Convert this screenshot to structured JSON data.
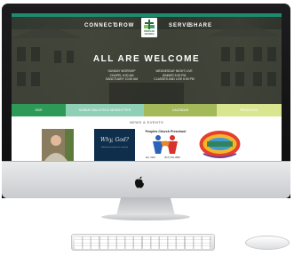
{
  "nav": {
    "connect": "CONNECT",
    "grow": "GROW",
    "serve": "SERVE",
    "share": "SHARE",
    "logo_text": "PEOPLES CHURCH"
  },
  "hero": {
    "headline": "ALL ARE WELCOME",
    "service_left": [
      "SUNDAY WORSHIP",
      "CHAPEL 8:30 AM",
      "SANCTUARY 10:30 AM"
    ],
    "service_right": [
      "WEDNESDAY NIGHT LIVE",
      "DINNER 5:30 PM",
      "CLASSES AND LIVE 6:30 PM"
    ]
  },
  "tabs": [
    "GIVE",
    "SUNDAY BULLETIN & NEWSLETTER",
    "CALENDAR",
    "PRESCHOOL"
  ],
  "news": {
    "title": "NEWS & EVENTS",
    "why_god_title": "Why, God?",
    "why_god_sub": "Suffering through loss and pain",
    "preschool_title": "Peoples Church Preschool",
    "preschool_est": "Est. 1961",
    "preschool_phone": "(517) 351-3880"
  },
  "colors": {
    "tab_give": "#2e9a57",
    "tab_bulletin": "#8fcfb5",
    "tab_calendar": "#a3b95a",
    "tab_preschool": "#d9e58f",
    "accent": "#1e8a6f"
  },
  "icons": [
    "apple-logo-icon"
  ]
}
